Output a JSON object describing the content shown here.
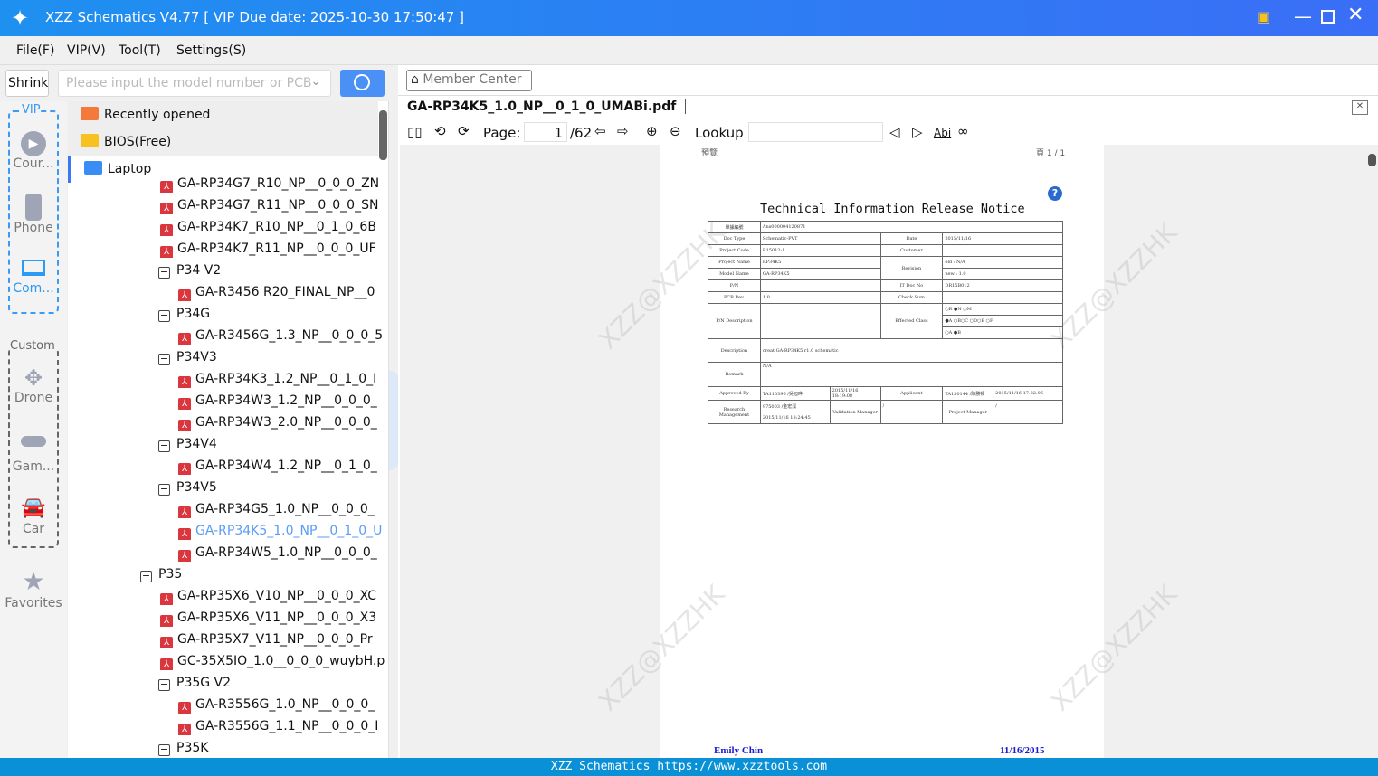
{
  "window": {
    "title": "XZZ Schematics V4.77 [ VIP Due date: 2025-10-30 17:50:47 ]"
  },
  "menu": [
    "File(F)",
    "VIP(V)",
    "Tool(T)",
    "Settings(S)"
  ],
  "search": {
    "shrink_label": "Shrink",
    "placeholder": "Please input the model number or PCB"
  },
  "rail": {
    "vip_label": "VIP",
    "custom_label": "Custom",
    "items": [
      "Cour...",
      "Phone",
      "Com...",
      "Drone",
      "Gam...",
      "Car",
      "Favorites"
    ]
  },
  "tree": [
    {
      "label": "Recently opened",
      "type": "folder",
      "color": "#f5793a",
      "level": 0
    },
    {
      "label": "BIOS(Free)",
      "type": "folder",
      "color": "#f7c21f",
      "level": 0
    },
    {
      "label": "Laptop",
      "type": "folder",
      "color": "#3a8df5",
      "level": 0,
      "selected": true
    },
    {
      "label": "GA-RP34G7_R10_NP__0_0_0_ZN",
      "type": "file",
      "level": 1
    },
    {
      "label": "GA-RP34G7_R11_NP__0_0_0_SN",
      "type": "file",
      "level": 1
    },
    {
      "label": "GA-RP34K7_R10_NP__0_1_0_6B",
      "type": "file",
      "level": 1
    },
    {
      "label": "GA-RP34K7_R11_NP__0_0_0_UF",
      "type": "file",
      "level": 1
    },
    {
      "label": "P34 V2",
      "type": "group",
      "level": 1
    },
    {
      "label": "GA-R3456 R20_FINAL_NP__0",
      "type": "file",
      "level": 2
    },
    {
      "label": "P34G",
      "type": "group",
      "level": 1
    },
    {
      "label": "GA-R3456G_1.3_NP__0_0_0_5",
      "type": "file",
      "level": 2
    },
    {
      "label": "P34V3",
      "type": "group",
      "level": 1
    },
    {
      "label": "GA-RP34K3_1.2_NP__0_1_0_I",
      "type": "file",
      "level": 2
    },
    {
      "label": "GA-RP34W3_1.2_NP__0_0_0_",
      "type": "file",
      "level": 2
    },
    {
      "label": "GA-RP34W3_2.0_NP__0_0_0_",
      "type": "file",
      "level": 2
    },
    {
      "label": "P34V4",
      "type": "group",
      "level": 1
    },
    {
      "label": "GA-RP34W4_1.2_NP__0_1_0_",
      "type": "file",
      "level": 2
    },
    {
      "label": "P34V5",
      "type": "group",
      "level": 1
    },
    {
      "label": "GA-RP34G5_1.0_NP__0_0_0_",
      "type": "file",
      "level": 2
    },
    {
      "label": "GA-RP34K5_1.0_NP__0_1_0_U",
      "type": "file",
      "level": 2,
      "active": true
    },
    {
      "label": "GA-RP34W5_1.0_NP__0_0_0_",
      "type": "file",
      "level": 2
    },
    {
      "label": "P35",
      "type": "group",
      "level": 0
    },
    {
      "label": "GA-RP35X6_V10_NP__0_0_0_XC",
      "type": "file",
      "level": 1
    },
    {
      "label": "GA-RP35X6_V11_NP__0_0_0_X3",
      "type": "file",
      "level": 1
    },
    {
      "label": "GA-RP35X7_V11_NP__0_0_0_Pr",
      "type": "file",
      "level": 1
    },
    {
      "label": "GC-35X5IO_1.0__0_0_0_wuybH.p",
      "type": "file",
      "level": 1
    },
    {
      "label": "P35G V2",
      "type": "group",
      "level": 1
    },
    {
      "label": "GA-R3556G_1.0_NP__0_0_0_",
      "type": "file",
      "level": 2
    },
    {
      "label": "GA-R3556G_1.1_NP__0_0_0_I",
      "type": "file",
      "level": 2
    },
    {
      "label": "P35K",
      "type": "group",
      "level": 1
    }
  ],
  "viewer": {
    "member_center": "Member Center",
    "file_tab": "GA-RP34K5_1.0_NP__0_1_0_UMABi.pdf",
    "page_label": "Page:",
    "page_value": "1",
    "page_total": "/62",
    "lookup_label": "Lookup",
    "lookup_value": "",
    "abi": "Abi"
  },
  "doc": {
    "header_left": "預覽",
    "header_right": "頁 1 / 1",
    "title": "Technical Information Release Notice",
    "r1": [
      "單據編號",
      "Ans000004120871"
    ],
    "r2": [
      "Doc Type",
      "Schematic-PVT",
      "Date",
      "2015/11/16"
    ],
    "r3": [
      "Project Code",
      "R15012-1",
      "Customer",
      ""
    ],
    "r4": [
      "Project Name",
      "RP34K5",
      "Revision",
      "old : N/A"
    ],
    "r5": [
      "Model Name",
      "GA-RP34K5",
      "new : 1.0"
    ],
    "r6": [
      "P/N",
      "",
      "IT Doc No",
      "DR15B012"
    ],
    "r7": [
      "PCB Rev.",
      "1.0",
      "Check Sum",
      ""
    ],
    "r8": [
      "P/N Description",
      "",
      "Effected Class",
      "○R ●N ○M",
      "●A ○B○C ○D○E ○F",
      "○A ●B"
    ],
    "r9": [
      "Description",
      "creat GA-RP34K5 r1.0 schematic"
    ],
    "r10": [
      "Remark",
      "N/A"
    ],
    "r11": [
      "Approved By",
      "TA110396 /吳旭晔",
      "2015/11/16 18:19:08",
      "Applicant",
      "TA130144 /陳勝頓",
      "2015/11/16 17:32:06"
    ],
    "r12": [
      "Research Management",
      "975003 /金宏潔",
      "Validation Manager",
      "/",
      "Project Manager",
      "/",
      "2015/11/16 18:24:45"
    ],
    "footer_name": "Emily Chin",
    "footer_date": "11/16/2015",
    "watermark": "XZZ@XZZHK"
  },
  "status": "XZZ Schematics https://www.xzztools.com"
}
